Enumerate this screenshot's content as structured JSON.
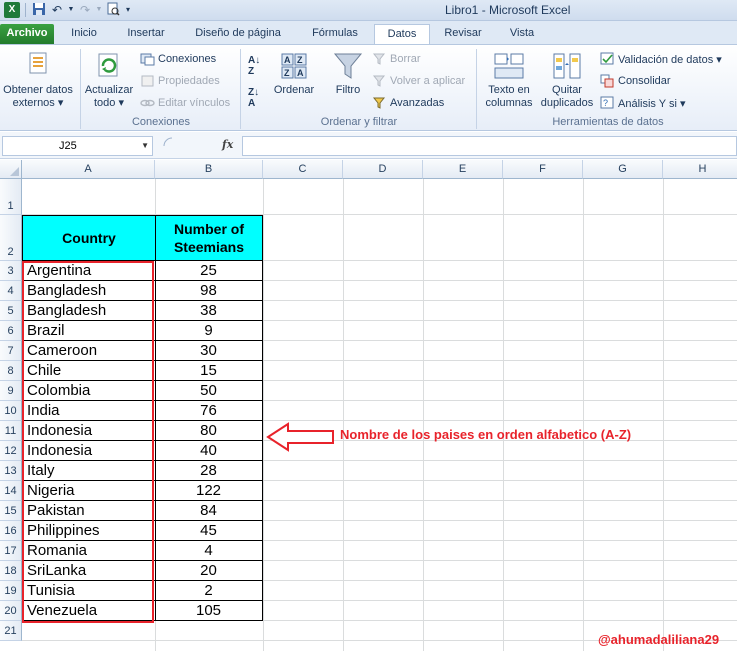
{
  "window": {
    "title": "Libro1  -  Microsoft Excel"
  },
  "tabs": [
    "Archivo",
    "Inicio",
    "Insertar",
    "Diseño de página",
    "Fórmulas",
    "Datos",
    "Revisar",
    "Vista"
  ],
  "ribbon": {
    "obtener": [
      "Obtener datos",
      "externos ▾"
    ],
    "actualizar": [
      "Actualizar",
      "todo ▾"
    ],
    "conexiones": "Conexiones",
    "propiedades": "Propiedades",
    "editar_vinculos": "Editar vínculos",
    "group_conexiones": "Conexiones",
    "ordenar": "Ordenar",
    "filtro": "Filtro",
    "borrar": "Borrar",
    "volver_aplicar": "Volver a aplicar",
    "avanzadas": "Avanzadas",
    "group_ordenar": "Ordenar y filtrar",
    "texto_columnas": [
      "Texto en",
      "columnas"
    ],
    "quitar_duplicados": [
      "Quitar",
      "duplicados"
    ],
    "validacion": "Validación de datos ▾",
    "consolidar": "Consolidar",
    "analisis": "Análisis Y si ▾",
    "group_herramientas": "Herramientas de datos"
  },
  "formula_bar": {
    "name_box": "J25",
    "fx": "fx",
    "value": ""
  },
  "columns": [
    "A",
    "B",
    "C",
    "D",
    "E",
    "F",
    "G",
    "H"
  ],
  "rows": [
    "1",
    "2",
    "3",
    "4",
    "5",
    "6",
    "7",
    "8",
    "9",
    "10",
    "11",
    "12",
    "13",
    "14",
    "15",
    "16",
    "17",
    "18",
    "19",
    "20",
    "21"
  ],
  "table": {
    "header_country": "Country",
    "header_number": "Number of Steemians",
    "rows": [
      {
        "country": "Argentina",
        "number": "25"
      },
      {
        "country": "Bangladesh",
        "number": "98"
      },
      {
        "country": "Bangladesh",
        "number": "38"
      },
      {
        "country": "Brazil",
        "number": "9"
      },
      {
        "country": "Cameroon",
        "number": "30"
      },
      {
        "country": "Chile",
        "number": "15"
      },
      {
        "country": "Colombia",
        "number": "50"
      },
      {
        "country": "India",
        "number": "76"
      },
      {
        "country": "Indonesia",
        "number": "80"
      },
      {
        "country": "Indonesia",
        "number": "40"
      },
      {
        "country": "Italy",
        "number": "28"
      },
      {
        "country": "Nigeria",
        "number": "122"
      },
      {
        "country": "Pakistan",
        "number": "84"
      },
      {
        "country": "Philippines",
        "number": "45"
      },
      {
        "country": "Romania",
        "number": "4"
      },
      {
        "country": "SriLanka",
        "number": "20"
      },
      {
        "country": "Tunisia",
        "number": "2"
      },
      {
        "country": "Venezuela",
        "number": "105"
      }
    ]
  },
  "annotation": "Nombre de los paises en orden alfabetico (A-Z)",
  "watermark": "@ahumadaliliana29",
  "colors": {
    "header_fill": "#00ffff",
    "annotation": "#e8232b"
  }
}
